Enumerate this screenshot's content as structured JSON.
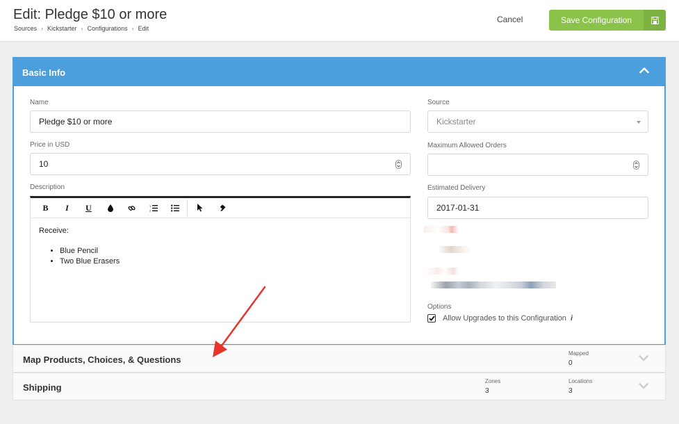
{
  "header": {
    "title": "Edit: Pledge $10 or more",
    "breadcrumb": [
      "Sources",
      "Kickstarter",
      "Configurations",
      "Edit"
    ],
    "cancel_label": "Cancel",
    "save_label": "Save Configuration",
    "save_color": "#8bc34a"
  },
  "basic_info": {
    "title": "Basic Info",
    "accent_color": "#4a9fdc",
    "name": {
      "label": "Name",
      "value": "Pledge $10 or more"
    },
    "price": {
      "label": "Price in USD",
      "value": "10"
    },
    "description": {
      "label": "Description",
      "toolbar": [
        "bold-icon",
        "italic-icon",
        "underline-icon",
        "color-drop-icon",
        "link-icon",
        "ordered-list-icon",
        "unordered-list-icon",
        "cursor-icon",
        "eraser-icon"
      ],
      "intro": "Receive:",
      "items": [
        "Blue Pencil",
        "Two Blue Erasers"
      ]
    },
    "source": {
      "label": "Source",
      "value": "Kickstarter"
    },
    "max_orders": {
      "label": "Maximum Allowed Orders",
      "value": ""
    },
    "delivery": {
      "label": "Estimated Delivery",
      "value": "2017-01-31"
    },
    "options": {
      "label": "Options",
      "allow_upgrades": {
        "label": "Allow Upgrades to this Configuration",
        "checked": true
      }
    }
  },
  "map_section": {
    "title": "Map Products, Choices, & Questions",
    "mapped_label": "Mapped",
    "mapped_value": "0"
  },
  "shipping_section": {
    "title": "Shipping",
    "zones_label": "Zones",
    "zones_value": "3",
    "locations_label": "Locations",
    "locations_value": "3"
  }
}
